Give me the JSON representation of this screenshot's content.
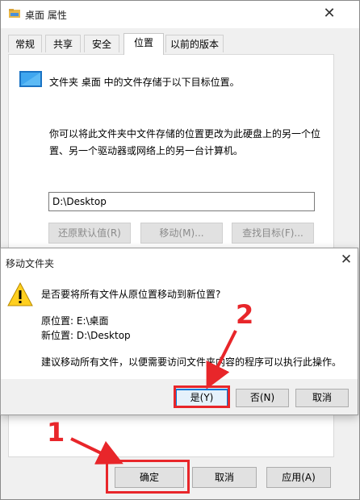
{
  "window": {
    "title": "桌面 属性",
    "tabs": [
      "常规",
      "共享",
      "安全",
      "位置",
      "以前的版本"
    ],
    "active_tab": "位置",
    "description": "文件夹 桌面 中的文件存储于以下目标位置。",
    "note": "你可以将此文件夹中文件存储的位置更改为此硬盘上的另一个位置、另一个驱动器或网络上的另一台计算机。",
    "path_value": "D:\\Desktop",
    "restore_button": "还原默认值(R)",
    "move_button": "移动(M)...",
    "find_target_button": "查找目标(F)...",
    "ok_button": "确定",
    "cancel_button": "取消",
    "apply_button": "应用(A)"
  },
  "move_dialog": {
    "title": "移动文件夹",
    "question": "是否要将所有文件从原位置移动到新位置?",
    "original": "原位置: E:\\桌面",
    "new": "新位置: D:\\Desktop",
    "advice": "建议移动所有文件，以便需要访问文件夹内容的程序可以执行此操作。",
    "yes": "是(Y)",
    "no": "否(N)",
    "cancel": "取消"
  },
  "annotations": {
    "step1": "1",
    "step2": "2",
    "color": "#e8262a"
  }
}
